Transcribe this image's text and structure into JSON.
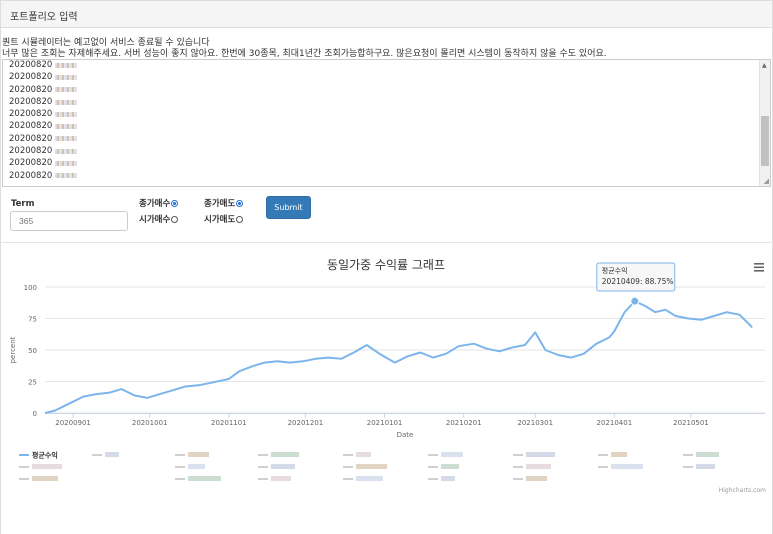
{
  "panel": {
    "title": "포트폴리오 입력"
  },
  "notice": {
    "line1": "퀀트 시뮬레이터는 예고없이 서비스 종료될 수 있습니다",
    "line2": "너무 많은 조회는 자제해주세요. 서버 성능이 좋지 않아요. 한번에 30종목, 최대1년간 조회가능합하구요. 많은요청이 몰리면 시스템이 동작하지 않을 수도 있어요."
  },
  "portfolio_lines": [
    "20200820",
    "20200820",
    "20200820",
    "20200820",
    "20200820",
    "20200820",
    "20200820",
    "20200820",
    "20200820",
    "20200820"
  ],
  "form": {
    "term_label": "Term",
    "term_placeholder": "365",
    "buy_close": "종가매수",
    "buy_open": "시가매수",
    "sell_close": "종가매도",
    "sell_open": "시가매도",
    "submit": "Submit"
  },
  "chart_data": {
    "type": "line",
    "title": "동일가중 수익률 그래프",
    "xlabel": "Date",
    "ylabel": "percent",
    "ylim": [
      0,
      100
    ],
    "yticks": [
      0,
      25,
      50,
      75,
      100
    ],
    "xticks": [
      "20200901",
      "20201001",
      "20201101",
      "20201201",
      "20210101",
      "20210201",
      "20210301",
      "20210401",
      "20210501"
    ],
    "grid": true,
    "legend_position": "bottom",
    "series_color": "#7cb5ec",
    "series": [
      {
        "name": "평균수익",
        "x": [
          "20200821",
          "20200825",
          "20200828",
          "20200901",
          "20200905",
          "20200910",
          "20200915",
          "20200920",
          "20200925",
          "20200930",
          "20201005",
          "20201010",
          "20201015",
          "20201020",
          "20201025",
          "20201101",
          "20201105",
          "20201110",
          "20201115",
          "20201120",
          "20201125",
          "20201130",
          "20201205",
          "20201210",
          "20201215",
          "20201220",
          "20201225",
          "20201230",
          "20210105",
          "20210110",
          "20210115",
          "20210120",
          "20210125",
          "20210130",
          "20210205",
          "20210210",
          "20210215",
          "20210220",
          "20210225",
          "20210301",
          "20210305",
          "20210310",
          "20210315",
          "20210320",
          "20210325",
          "20210330",
          "20210401",
          "20210405",
          "20210409",
          "20210413",
          "20210417",
          "20210421",
          "20210425",
          "20210430",
          "20210505",
          "20210510",
          "20210515",
          "20210520",
          "20210525"
        ],
        "values": [
          0,
          2,
          5,
          9,
          13,
          15,
          16,
          19,
          14,
          12,
          15,
          18,
          21,
          22,
          24,
          27,
          33,
          37,
          40,
          41,
          40,
          41,
          43,
          44,
          43,
          48,
          54,
          47,
          40,
          45,
          48,
          44,
          47,
          53,
          55,
          51,
          49,
          52,
          54,
          64,
          50,
          46,
          44,
          47,
          55,
          60,
          65,
          80,
          88.75,
          85,
          80,
          82,
          77,
          75,
          74,
          77,
          80,
          78,
          68
        ]
      }
    ],
    "tooltip": {
      "header": "평균수익",
      "body": "20210409: 88.75%"
    },
    "credits": "Highcharts.com"
  }
}
